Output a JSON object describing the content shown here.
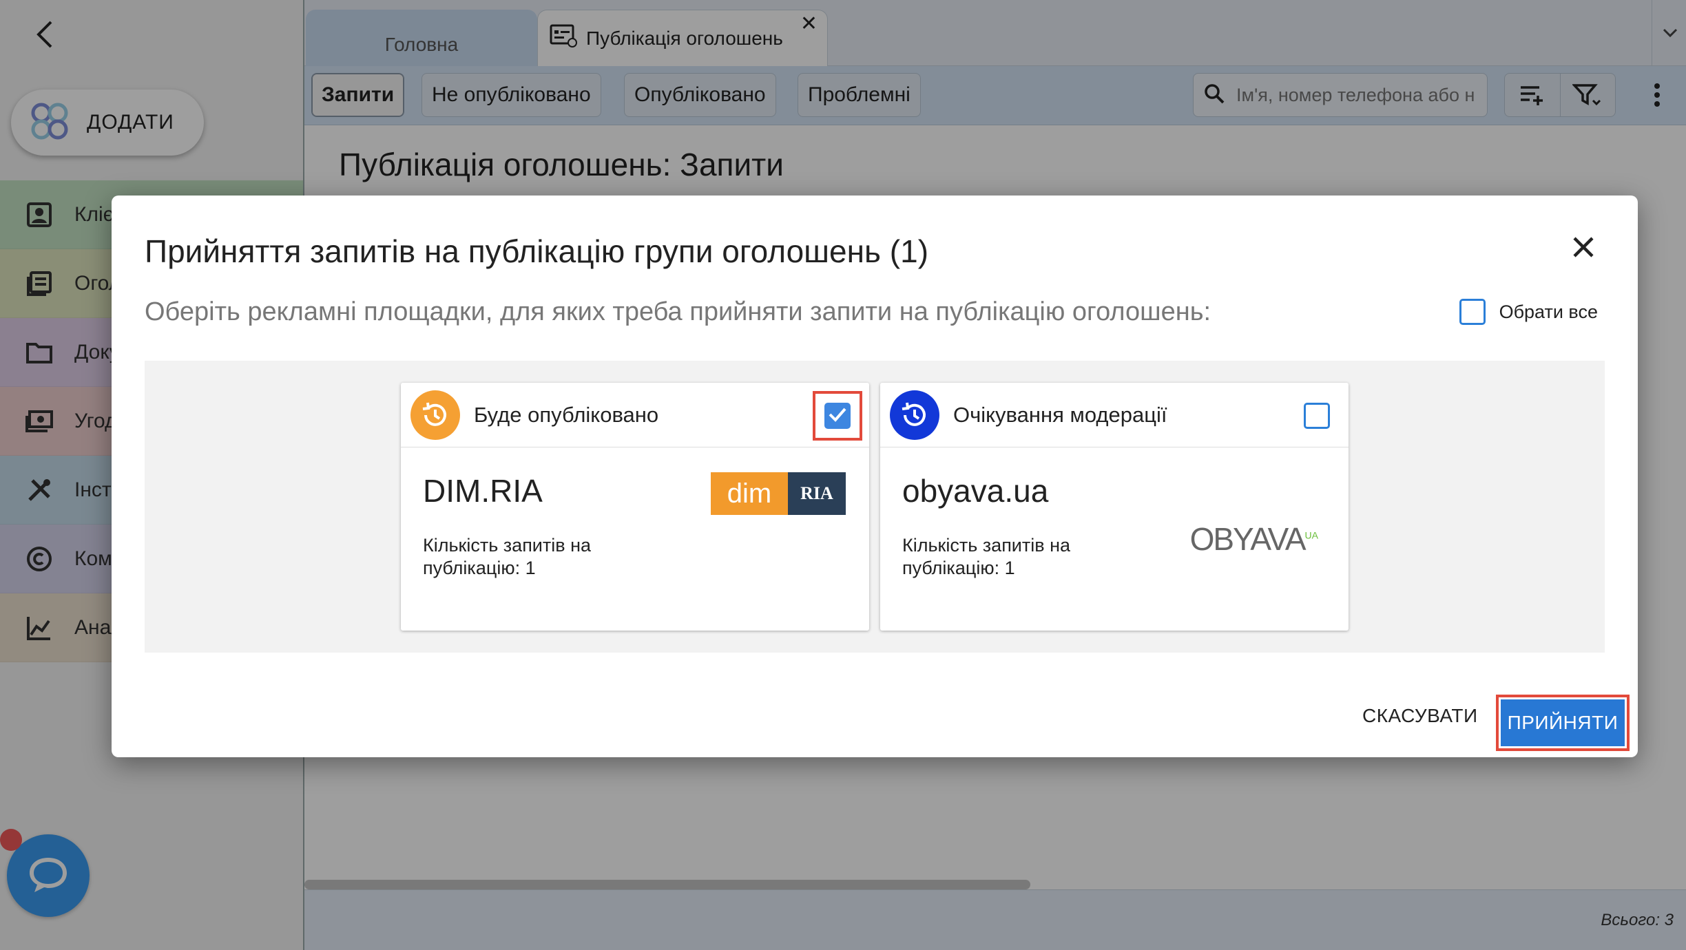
{
  "sidebar": {
    "add_label": "ДОДАТИ",
    "items": [
      {
        "label": "Клієнти",
        "icon": "contacts-icon",
        "color": "#c3e3c3"
      },
      {
        "label": "Оголошення",
        "icon": "listing-icon",
        "color": "#dfe5bf"
      },
      {
        "label": "Документи",
        "icon": "folder-icon",
        "color": "#e1cfe9"
      },
      {
        "label": "Угоди",
        "icon": "money-icon",
        "color": "#efcfcf"
      },
      {
        "label": "Інструменти",
        "icon": "tools-icon",
        "color": "#c6dceb"
      },
      {
        "label": "Комісії",
        "icon": "copyright-icon",
        "color": "#d6d4ec"
      },
      {
        "label": "Аналітика",
        "icon": "analytics-icon",
        "color": "#ece0cf"
      }
    ]
  },
  "tabs": {
    "home": "Головна",
    "active": "Публікація оголошень"
  },
  "toolbar": {
    "chips": [
      "Запити",
      "Не опубліковано",
      "Опубліковано",
      "Проблемні"
    ],
    "search_placeholder": "Ім'я, номер телефона або н"
  },
  "page": {
    "title": "Публікація оголошень: Запити",
    "total": "Всього: 3"
  },
  "modal": {
    "title": "Прийняття запитів на публікацію групи оголошень (1)",
    "subtitle": "Оберіть рекламні площадки, для яких треба прийняти запити на публікацію оголошень:",
    "select_all": "Обрати все",
    "cards": [
      {
        "status": "Буде опубліковано",
        "status_color": "#f5a033",
        "name": "DIM.RIA",
        "count": "Кількість запитів на публікацію: 1",
        "checked": true,
        "logo_left": "dim",
        "logo_right": "RIA"
      },
      {
        "status": "Очікування модерації",
        "status_color": "#1238d8",
        "name": "obyava.ua",
        "count": "Кількість запитів на публікацію: 1",
        "checked": false,
        "logo_text": "OBYAVA",
        "logo_sup": "UA"
      }
    ],
    "cancel": "СКАСУВАТИ",
    "accept": "ПРИЙНЯТИ"
  }
}
